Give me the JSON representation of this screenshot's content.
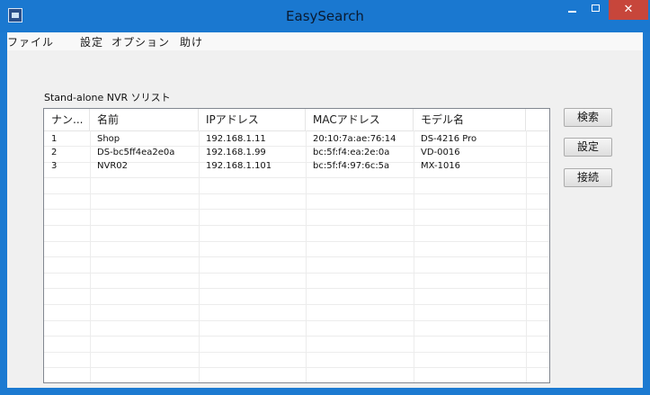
{
  "window": {
    "title": "EasySearch",
    "close_glyph": "✕"
  },
  "menu": [
    "ファイル",
    "設定",
    "オプション",
    "助け"
  ],
  "list_group_label": "Stand-alone NVR ソリスト",
  "table": {
    "columns": [
      "ナン...",
      "名前",
      "IPアドレス",
      "MACアドレス",
      "モデル名"
    ],
    "rows": [
      [
        "1",
        "Shop",
        "192.168.1.11",
        "20:10:7a:ae:76:14",
        "DS-4216 Pro"
      ],
      [
        "2",
        "DS-bc5ff4ea2e0a",
        "192.168.1.99",
        "bc:5f:f4:ea:2e:0a",
        "VD-0016"
      ],
      [
        "3",
        "NVR02",
        "192.168.1.101",
        "bc:5f:f4:97:6c:5a",
        "MX-1016"
      ]
    ]
  },
  "buttons": {
    "search": "検索",
    "settings": "設定",
    "connect": "接続"
  },
  "icons": {
    "app": "app-icon",
    "minimize": "minimize-icon",
    "maximize": "maximize-icon",
    "close": "close-icon"
  }
}
